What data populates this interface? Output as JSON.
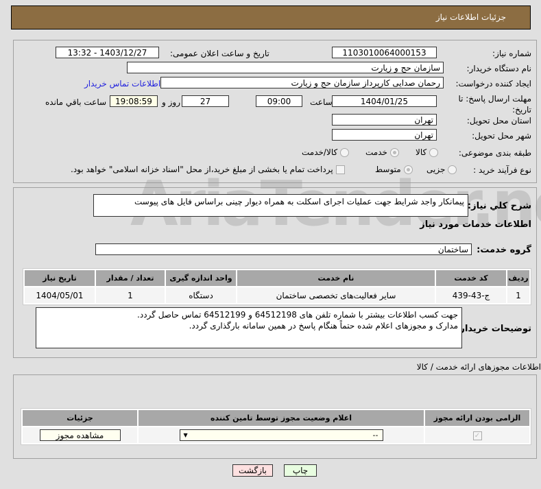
{
  "header": {
    "title": "جزئیات اطلاعات نیاز"
  },
  "fields": {
    "need_number_label": "شماره نیاز:",
    "need_number": "1103010064000153",
    "announce_label": "تاریخ و ساعت اعلان عمومی:",
    "announce_value": "1403/12/27 - 13:32",
    "buyer_org_label": "نام دستگاه خریدار:",
    "buyer_org": "سازمان حج و زیارت",
    "creator_label": "ایجاد کننده درخواست:",
    "creator": "رحمان  صدایی کارپرداز سازمان حج و زیارت",
    "contact_link": "اطلاعات تماس خریدار",
    "deadline_label": "مهلت ارسال پاسخ: تا تاریخ:",
    "deadline_date": "1404/01/25",
    "time_label": "ساعت",
    "deadline_time": "09:00",
    "days": "27",
    "days_label": "روز و",
    "remaining": "19:08:59",
    "remaining_label": "ساعت باقي مانده",
    "province_label": "استان محل تحویل:",
    "province": "تهران",
    "city_label": "شهر محل تحویل:",
    "city": "تهران",
    "category_label": "طبقه بندی موضوعی:",
    "category_options": [
      "کالا",
      "خدمت",
      "کالا/خدمت"
    ],
    "category_selected": "خدمت",
    "process_label": "نوع فرآیند خرید :",
    "process_options": [
      "جزیی",
      "متوسط"
    ],
    "process_selected": "متوسط",
    "payment_note": "پرداخت تمام یا بخشی از مبلغ خرید،از محل \"اسناد خزانه اسلامی\" خواهد بود."
  },
  "description": {
    "label": "شرح کلي نیاز:",
    "value": "پیمانکار واجد شرایط جهت عملیات اجرای اسکلت به همراه دیوار چینی براساس فایل های پیوست"
  },
  "services": {
    "heading": "اطلاعات خدمات مورد نیاز",
    "group_label": "گروه خدمت:",
    "group": "ساختمان",
    "columns": [
      "ردیف",
      "کد خدمت",
      "نام خدمت",
      "واحد اندازه گیری",
      "تعداد / مقدار",
      "تاریخ نیاز"
    ],
    "rows": [
      [
        "1",
        "ج-43-439",
        "سایر فعالیت‌های تخصصی ساختمان",
        "دستگاه",
        "1",
        "1404/05/01"
      ]
    ]
  },
  "buyer_notes": {
    "label": "توضیحات خریدار:",
    "lines": [
      "جهت کسب اطلاعات بیشتر با شماره تلفن های 64512198 و 64512199 تماس حاصل گردد.",
      "مدارک و مجوزهای اعلام شده حتماً هنگام پاسخ در همین سامانه بارگذاری گردد."
    ]
  },
  "permits": {
    "section_title": "اطلاعات مجوزهای ارائه خدمت / کالا",
    "columns": [
      "الزامی بودن ارائه مجوز",
      "اعلام وضعیت مجوز توسط تامین کننده",
      "جزئیات"
    ],
    "select_value": "--",
    "view_button": "مشاهده مجوز"
  },
  "buttons": {
    "print": "چاپ",
    "back": "بازگشت"
  },
  "watermark": "AriaTender.neT"
}
